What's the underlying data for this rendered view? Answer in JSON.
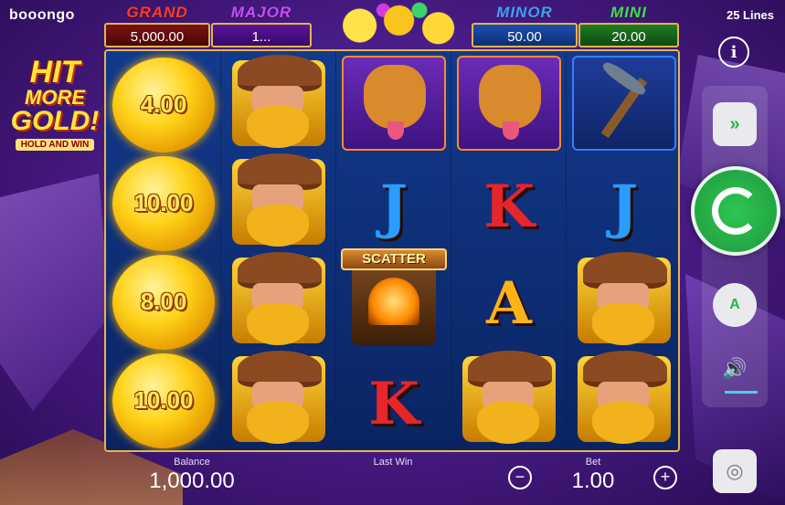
{
  "header": {
    "brand": "booongo",
    "lines": "25 Lines"
  },
  "logo": {
    "line1": "HIT",
    "line2": "MORE",
    "line3": "GOLD!",
    "tag": "HOLD AND WIN"
  },
  "jackpots": {
    "grand": {
      "name": "GRAND",
      "value": "5,000.00"
    },
    "major": {
      "name": "MAJOR",
      "value": "1..."
    },
    "minor": {
      "name": "MINOR",
      "value": "50.00"
    },
    "mini": {
      "name": "MINI",
      "value": "20.00"
    }
  },
  "reels": {
    "reel1": [
      "4.00",
      "10.00",
      "8.00",
      "10.00"
    ],
    "reel2": [
      "miner",
      "miner",
      "miner",
      "miner"
    ],
    "reel3": [
      "dog",
      "J",
      "SCATTER",
      "K"
    ],
    "reel4": [
      "dog",
      "K",
      "A",
      "miner"
    ],
    "reel5": [
      "pickaxe",
      "J",
      "miner",
      "miner"
    ],
    "scatter_label": "SCATTER",
    "letters": {
      "r3_1": "J",
      "r3_3": "K",
      "r4_1": "K",
      "r4_2": "A",
      "r5_1": "J"
    }
  },
  "footer": {
    "balance_label": "Balance",
    "balance_value": "1,000.00",
    "lastwin_label": "Last Win",
    "lastwin_value": "",
    "bet_label": "Bet",
    "bet_value": "1.00",
    "minus": "−",
    "plus": "+"
  },
  "controls": {
    "info": "i",
    "turbo": "»",
    "auto": "A",
    "sound": "🔊",
    "coins": "◎",
    "colors": {
      "spin": "#1f9a3c",
      "accent": "#2bb34a"
    }
  }
}
